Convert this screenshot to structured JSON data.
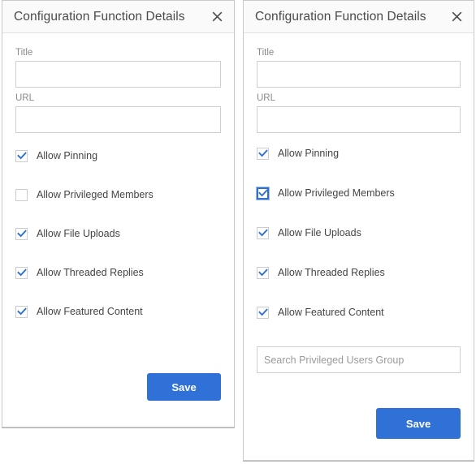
{
  "theme": {
    "accent": "#3071d8",
    "focus_ring": "#2f6fd0",
    "panel_border": "#c9c9c9",
    "header_bg": "#fafafa",
    "label_color": "#8a8a8a",
    "text_color": "#444444",
    "input_border": "#cfcfcf",
    "checkbox_border": "#cccccc"
  },
  "dialogs": [
    {
      "id": "left",
      "title": "Configuration Function Details",
      "close_icon": "close-icon",
      "fields": [
        {
          "label": "Title",
          "value": "",
          "placeholder": ""
        },
        {
          "label": "URL",
          "value": "",
          "placeholder": ""
        }
      ],
      "checkboxes": [
        {
          "label": "Allow Pinning",
          "checked": true,
          "focused": false
        },
        {
          "label": "Allow Privileged Members",
          "checked": false,
          "focused": false
        },
        {
          "label": "Allow File Uploads",
          "checked": true,
          "focused": false
        },
        {
          "label": "Allow Threaded Replies",
          "checked": true,
          "focused": false
        },
        {
          "label": "Allow Featured Content",
          "checked": true,
          "focused": false
        }
      ],
      "search": null,
      "save_label": "Save"
    },
    {
      "id": "right",
      "title": "Configuration Function Details",
      "close_icon": "close-icon",
      "fields": [
        {
          "label": "Title",
          "value": "",
          "placeholder": ""
        },
        {
          "label": "URL",
          "value": "",
          "placeholder": ""
        }
      ],
      "checkboxes": [
        {
          "label": "Allow Pinning",
          "checked": true,
          "focused": false
        },
        {
          "label": "Allow Privileged Members",
          "checked": true,
          "focused": true
        },
        {
          "label": "Allow File Uploads",
          "checked": true,
          "focused": false
        },
        {
          "label": "Allow Threaded Replies",
          "checked": true,
          "focused": false
        },
        {
          "label": "Allow Featured Content",
          "checked": true,
          "focused": false
        }
      ],
      "search": {
        "value": "",
        "placeholder": "Search Privileged Users Group"
      },
      "save_label": "Save"
    }
  ]
}
